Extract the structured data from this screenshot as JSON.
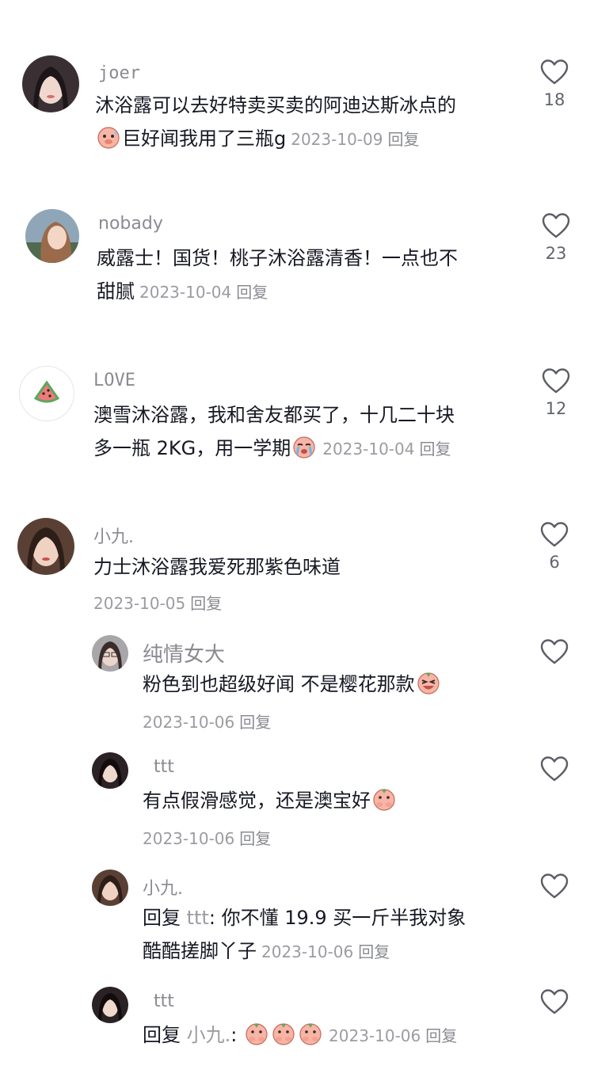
{
  "comments": [
    {
      "user": "joer",
      "line1": "沐浴露可以去好特卖买卖的阿迪达斯冰点的",
      "line2": "巨好闻我用了三瓶g",
      "date": "2023-10-09",
      "reply_label": "回复",
      "likes": "18",
      "emoji": "pig-sweat-icon"
    },
    {
      "user": "nobady",
      "line1": "威露士！国货！桃子沐浴露清香！一点也不",
      "line2": "甜腻",
      "date": "2023-10-04",
      "reply_label": "回复",
      "likes": "23"
    },
    {
      "user": "LOVE",
      "line1": "澳雪沐浴露，我和舍友都买了，十几二十块",
      "line2": "多一瓶 2KG，用一学期",
      "date": "2023-10-04",
      "reply_label": "回复",
      "likes": "12",
      "emoji": "pig-cry-icon"
    },
    {
      "user": "小九.",
      "line1": "力士沐浴露我爱死那紫色味道",
      "date": "2023-10-05",
      "reply_label": "回复",
      "likes": "6",
      "replies": [
        {
          "user": "纯情女大",
          "text": "粉色到也超级好闻 不是樱花那款",
          "date": "2023-10-06",
          "reply_label": "回复",
          "emoji": "pig-laugh-icon"
        },
        {
          "user": "ttt",
          "text": "有点假滑感觉，还是澳宝好",
          "date": "2023-10-06",
          "reply_label": "回复",
          "emoji": "pig-hold-icon"
        },
        {
          "user": "小九.",
          "prefix": "回复",
          "mention": "ttt",
          "line1": ": 你不懂 19.9 买一斤半我对象",
          "line2": "酷酷搓脚丫子",
          "date": "2023-10-06",
          "reply_label": "回复"
        },
        {
          "user": "ttt",
          "prefix": "回复",
          "mention": "小九.",
          "text": ":",
          "date": "2023-10-06",
          "reply_label": "回复",
          "emoji": "pig-hold-icon"
        }
      ]
    }
  ],
  "colors": {
    "text": "#161823",
    "meta": "#9b9ca2",
    "username": "#8a8b91",
    "heart": "#5c5e66"
  }
}
